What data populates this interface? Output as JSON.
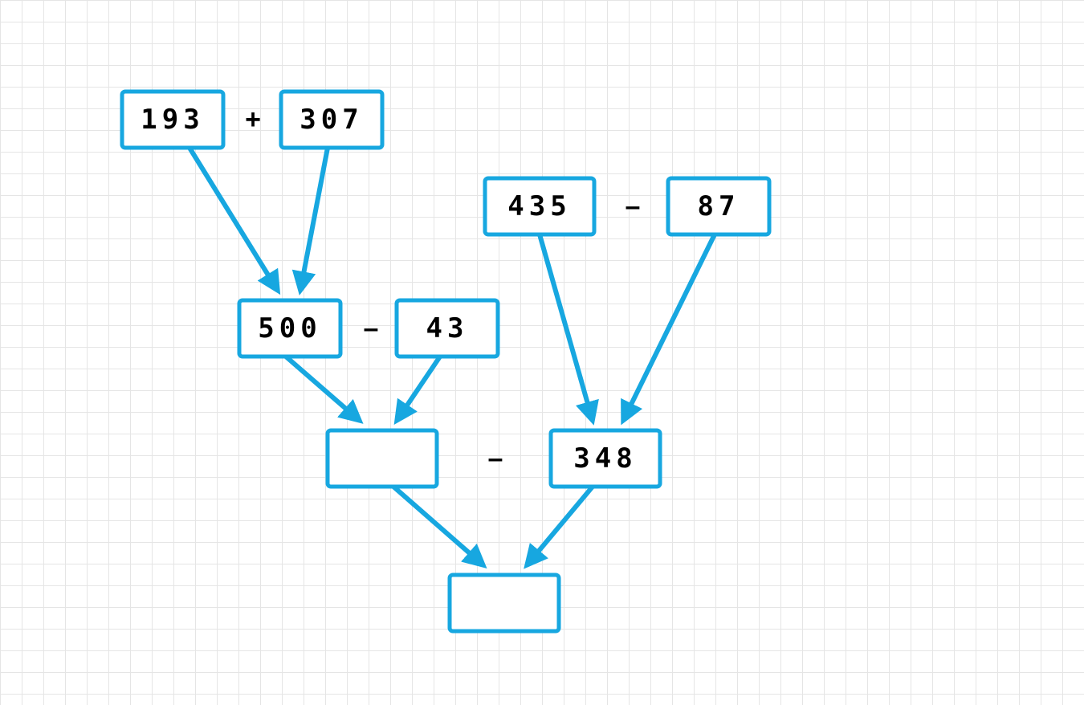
{
  "colors": {
    "accent": "#17a7e0",
    "grid": "#e5e5e5",
    "text": "#000000"
  },
  "row1": {
    "left": "193",
    "op": "+",
    "right": "307"
  },
  "row1b": {
    "left": "435",
    "op": "–",
    "right": "87"
  },
  "row2": {
    "left": "500",
    "op": "–",
    "right": "43"
  },
  "row3": {
    "left": "",
    "op": "–",
    "right": "348"
  },
  "row4": {
    "result": ""
  }
}
